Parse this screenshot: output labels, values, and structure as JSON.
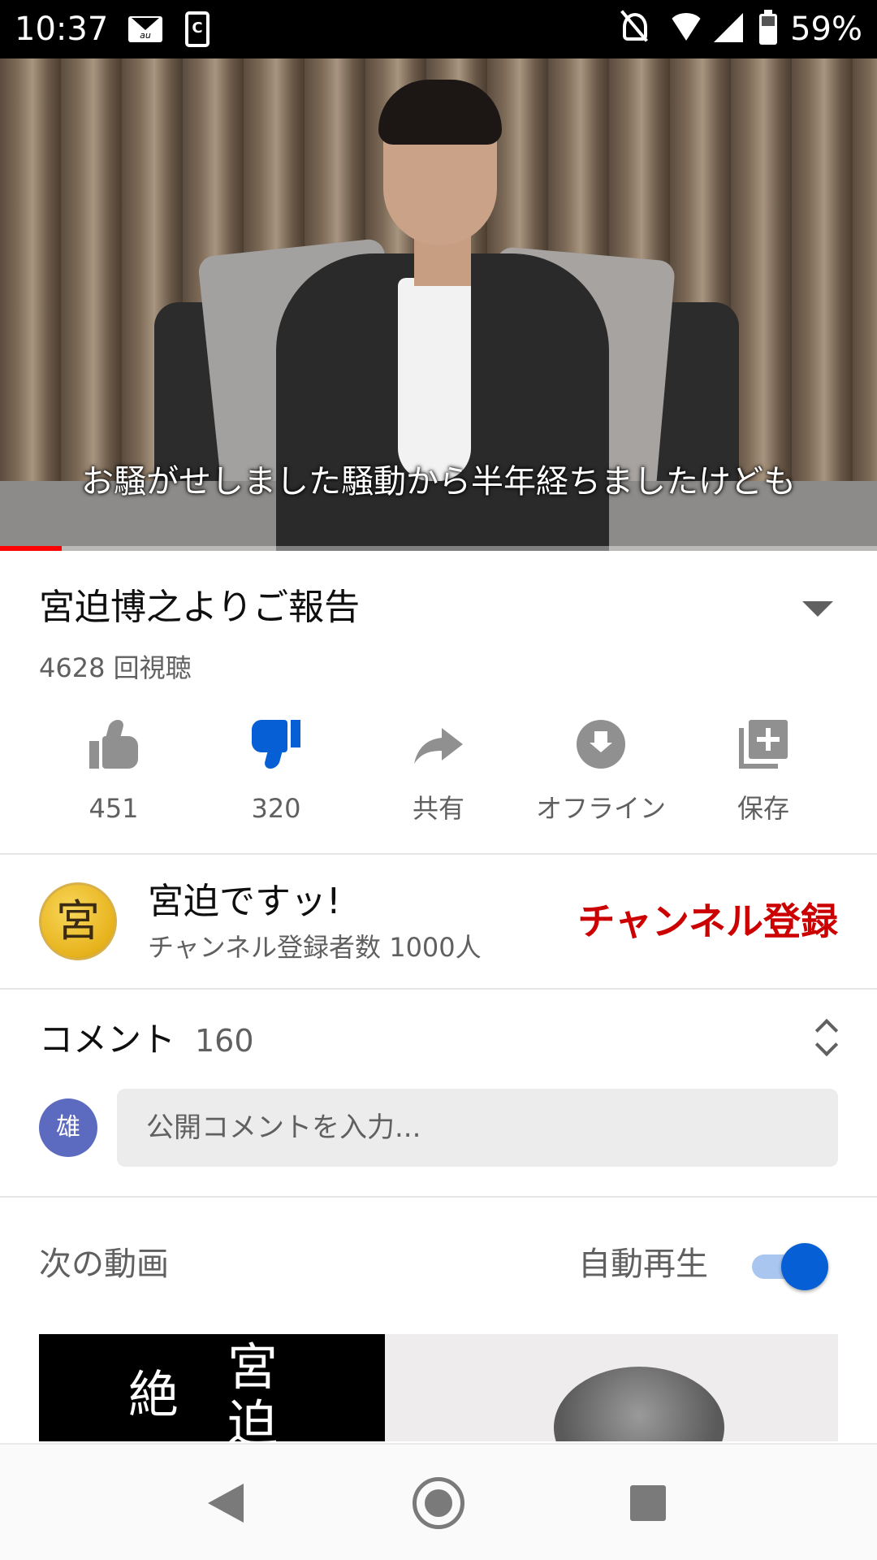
{
  "status_bar": {
    "time": "10:37",
    "mail_label": "au",
    "app_badge": "C",
    "battery": "59%"
  },
  "video": {
    "caption": "お騒がせしました騒動から半年経ちましたけども",
    "progress_percent": 7
  },
  "info": {
    "title": "宮迫博之よりご報告",
    "views": "4628 回視聴"
  },
  "actions": [
    {
      "label": "451",
      "icon": "thumb-up-icon"
    },
    {
      "label": "320",
      "icon": "thumb-down-icon",
      "active": true,
      "color": "#065fd4"
    },
    {
      "label": "共有",
      "icon": "share-icon"
    },
    {
      "label": "オフライン",
      "icon": "download-icon"
    },
    {
      "label": "保存",
      "icon": "playlist-add-icon"
    }
  ],
  "channel": {
    "avatar_char": "宮",
    "name": "宮迫ですッ!",
    "subscribers": "チャンネル登録者数 1000人",
    "subscribe_label": "チャンネル登録",
    "subscribe_color": "#cc0000"
  },
  "comments": {
    "title": "コメント",
    "count": "160",
    "user_avatar": "雄",
    "placeholder": "公開コメントを入力..."
  },
  "up_next": {
    "title": "次の動画",
    "autoplay_label": "自動再生",
    "autoplay_on": true,
    "thumb_chars": [
      "宮",
      "迫",
      "絶"
    ]
  },
  "nav": {
    "back": "back-icon",
    "home": "home-icon",
    "recents": "recents-icon"
  }
}
